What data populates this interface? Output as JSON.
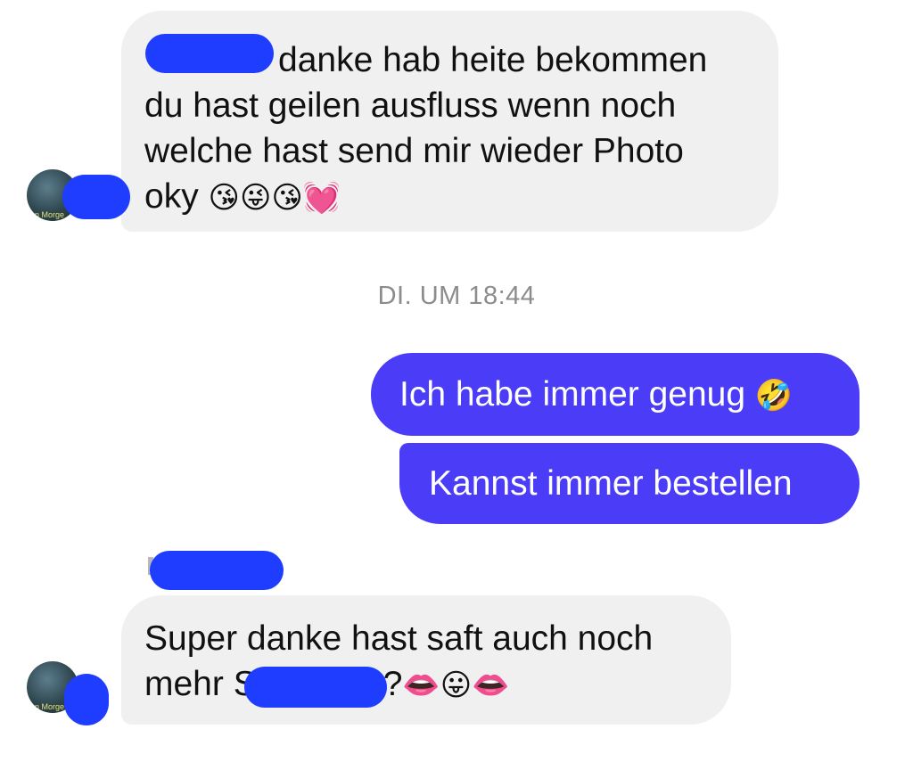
{
  "conversation": {
    "timestamp": "DI. UM 18:44",
    "messages": [
      {
        "direction": "incoming",
        "lines": [
          "danke hab heite bekommen",
          "du hast geilen ausfluss wenn noch",
          "welche hast send mir wieder Photo",
          "oky"
        ],
        "emojis": "😘😜😘💓"
      },
      {
        "direction": "outgoing",
        "text": "Ich habe immer genug",
        "emoji": "🤣"
      },
      {
        "direction": "outgoing",
        "text": "Kannst immer bestellen"
      },
      {
        "direction": "incoming",
        "lines": [
          "Super danke hast saft auch noch",
          "mehr"
        ],
        "line2_prefix": "S",
        "line2_suffix": "?",
        "emojis": "👄😛👄"
      }
    ],
    "avatar_caption": "en Morge",
    "colors": {
      "outgoing_bubble": "#4a3cf7",
      "incoming_bubble": "#f0f0f0",
      "redaction": "#1f3dff",
      "timestamp": "#8c8c8c"
    }
  }
}
